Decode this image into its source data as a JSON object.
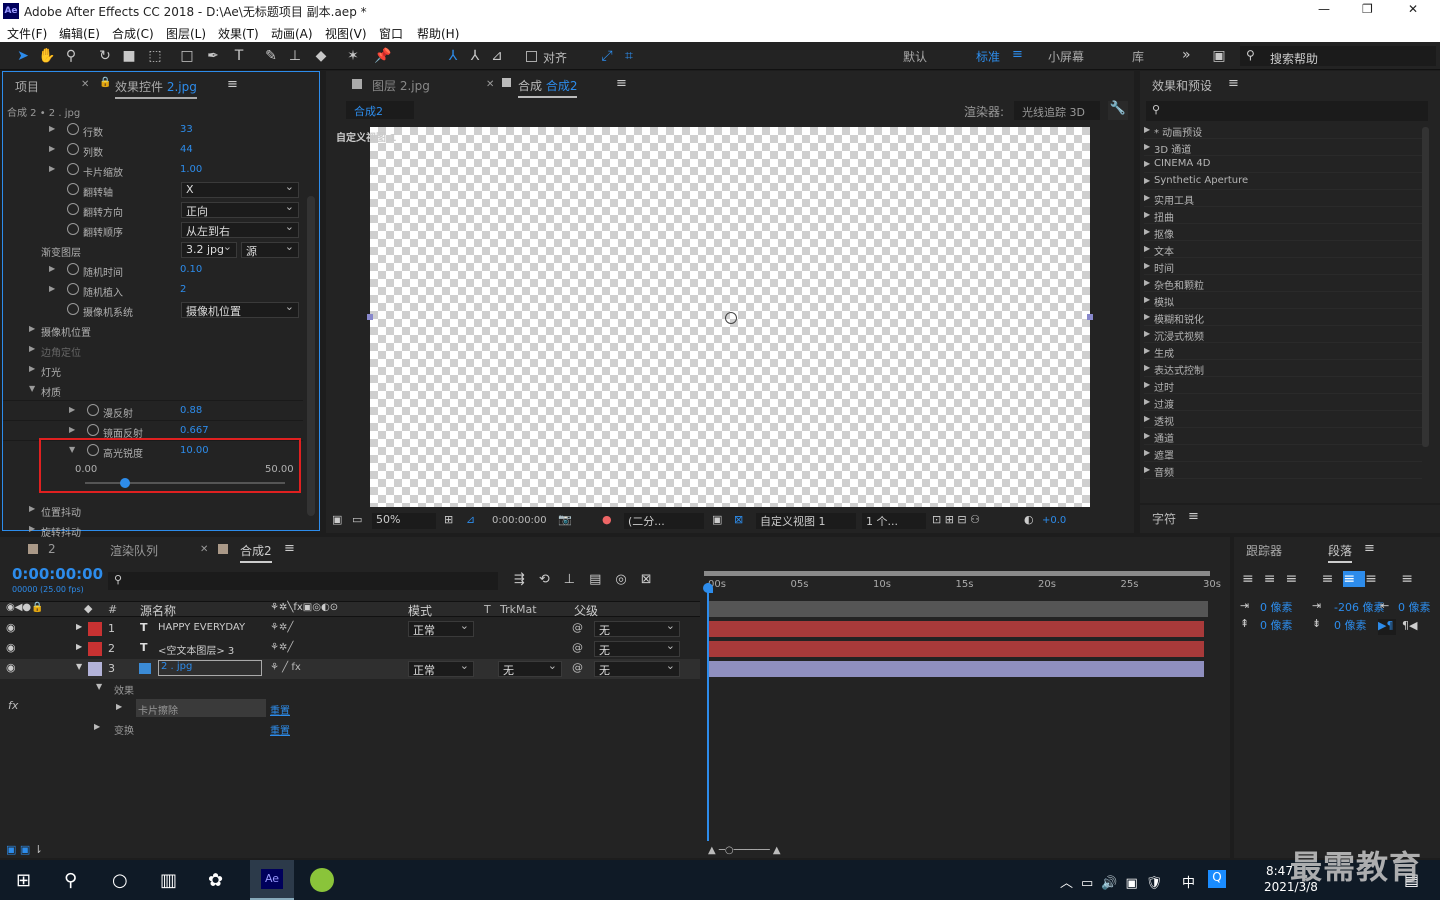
{
  "app": {
    "title": "Adobe After Effects CC 2018 - D:\\Ae\\无标题项目 副本.aep *",
    "logo": "Ae",
    "win_min": "—",
    "win_max": "❐",
    "win_close": "✕"
  },
  "menu": [
    "文件(F)",
    "编辑(E)",
    "合成(C)",
    "图层(L)",
    "效果(T)",
    "动画(A)",
    "视图(V)",
    "窗口",
    "帮助(H)"
  ],
  "toolbar": {
    "align_label": "对齐",
    "workspaces": [
      "默认",
      "标准",
      "小屏幕",
      "库"
    ],
    "active_workspace": "标准",
    "search_placeholder": "搜索帮助",
    "more": "»"
  },
  "left_panel": {
    "tab_project": "项目",
    "tab_effects": "效果控件",
    "tab_effects_file": "2.jpg",
    "breadcrumb": "合成 2 • 2 . jpg",
    "rows": [
      {
        "label": "行数",
        "value": "33"
      },
      {
        "label": "列数",
        "value": "44"
      },
      {
        "label": "卡片缩放",
        "value": "1.00"
      },
      {
        "label": "翻转轴",
        "dropdown": "X"
      },
      {
        "label": "翻转方向",
        "dropdown": "正向"
      },
      {
        "label": "翻转顺序",
        "dropdown": "从左到右"
      },
      {
        "label": "渐变图层",
        "dropdown": "3.2 jpg",
        "dropdown2": "源"
      },
      {
        "label": "随机时间",
        "value": "0.10"
      },
      {
        "label": "随机植入",
        "value": "2"
      },
      {
        "label": "摄像机系统",
        "dropdown": "摄像机位置"
      },
      {
        "label": "摄像机位置"
      },
      {
        "label": "边角定位"
      },
      {
        "label": "灯光"
      },
      {
        "label": "材质"
      },
      {
        "label": "漫反射",
        "value": "0.88"
      },
      {
        "label": "镜面反射",
        "value": "0.667"
      },
      {
        "label": "高光锐度",
        "value": "10.00"
      }
    ],
    "slider": {
      "min": "0.00",
      "max": "50.00",
      "value": 10,
      "range": 50
    },
    "after": [
      "位置抖动",
      "旋转抖动"
    ]
  },
  "comp_panel": {
    "tab_layer": "图层",
    "tab_layer_file": "2.jpg",
    "tab_comp": "合成",
    "tab_comp_name": "合成2",
    "subtab": "合成2",
    "renderer_label": "渲染器:",
    "renderer": "光线追踪 3D",
    "view_label": "自定义视图 1",
    "footer": {
      "zoom": "50%",
      "time": "0:00:00:00",
      "res": "(二分...",
      "view": "自定义视图 1",
      "views": "1 个...",
      "exposure": "+0.0"
    }
  },
  "effects_panel": {
    "title": "效果和预设",
    "search_icon": "⚲",
    "items": [
      "* 动画预设",
      "3D 通道",
      "CINEMA 4D",
      "Synthetic Aperture",
      "实用工具",
      "扭曲",
      "抠像",
      "文本",
      "时间",
      "杂色和颗粒",
      "模拟",
      "模糊和锐化",
      "沉浸式视频",
      "生成",
      "表达式控制",
      "过时",
      "过渡",
      "透视",
      "通道",
      "遮罩",
      "音频"
    ],
    "char_title": "字符"
  },
  "timeline": {
    "tab_2": "2",
    "tab_render": "渲染队列",
    "tab_comp": "合成2",
    "timecode": "0:00:00:00",
    "fps": "00000 (25.00 fps)",
    "headers": {
      "name": "源名称",
      "mode": "模式",
      "t": "T",
      "trkmat": "TrkMat",
      "parent": "父级"
    },
    "layers": [
      {
        "num": "1",
        "type": "T",
        "name": "HAPPY EVERYDAY",
        "mode": "正常",
        "trkmat": "",
        "parent": "无",
        "color": "#c83232"
      },
      {
        "num": "2",
        "type": "T",
        "name": "<空文本图层> 3",
        "mode": "",
        "trkmat": "",
        "parent": "无",
        "color": "#c83232"
      },
      {
        "num": "3",
        "type": "img",
        "name": "2 . jpg",
        "mode": "正常",
        "trkmat": "无",
        "parent": "无",
        "color": "#b3b3d9"
      }
    ],
    "sub": {
      "effects": "效果",
      "effect_name": "卡片擦除",
      "reset1": "重置",
      "transform": "变换",
      "reset2": "重置",
      "fx": "fx"
    },
    "ruler": [
      "00s",
      "05s",
      "10s",
      "15s",
      "20s",
      "25s",
      "30s"
    ]
  },
  "paragraph_panel": {
    "tab_tracker": "跟踪器",
    "tab_para": "段落",
    "indent_left": "0 像素",
    "indent_first": "-206 像素",
    "indent_right": "0 像素",
    "space_before": "0 像素",
    "space_after": "0 像素"
  },
  "taskbar": {
    "time": "8:47",
    "date": "2021/3/8",
    "ime": "中",
    "watermark": "最需教育"
  }
}
